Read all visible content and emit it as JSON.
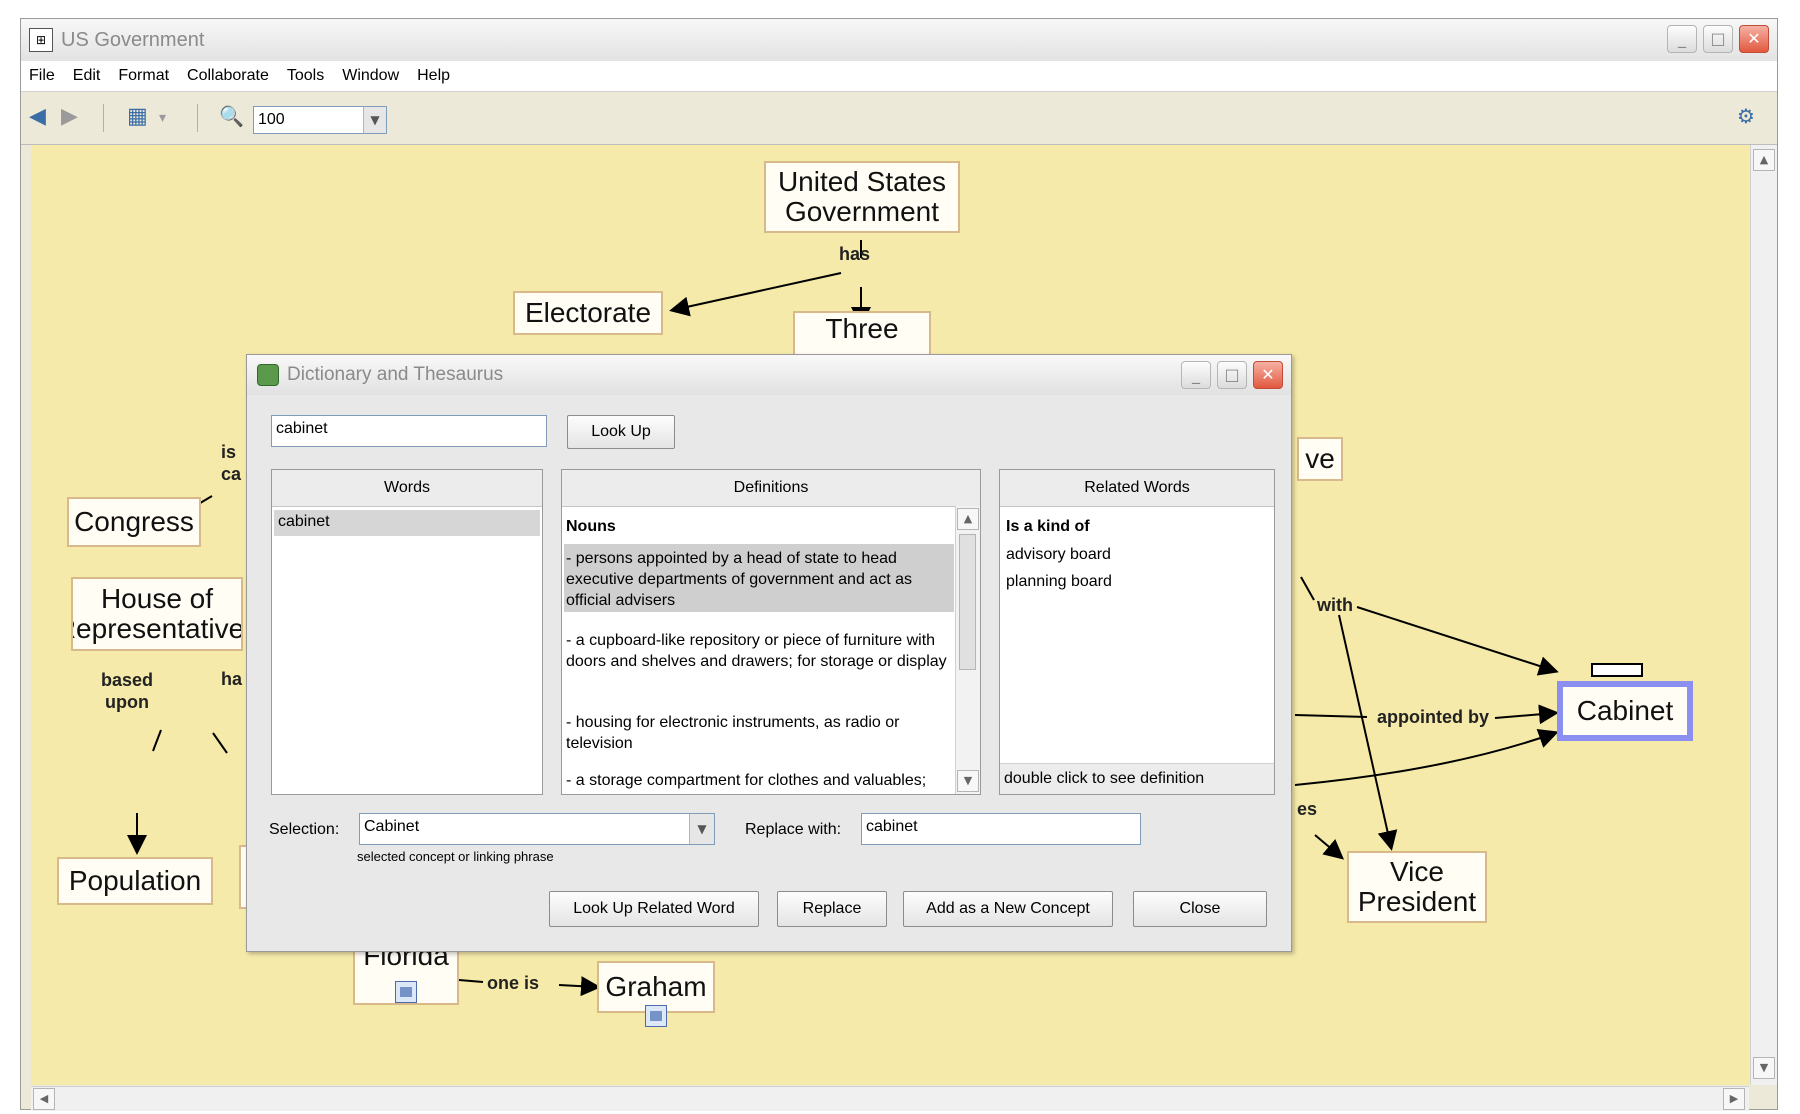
{
  "window": {
    "title": "US Government",
    "controls": {
      "minimize": "_",
      "maximize": "□",
      "close": "✕"
    }
  },
  "menu": [
    "File",
    "Edit",
    "Format",
    "Collaborate",
    "Tools",
    "Window",
    "Help"
  ],
  "toolbar": {
    "back_icon": "◀",
    "forward_icon": "▶",
    "view_icon": "▦",
    "dropdown_arrow": "▾",
    "zoom_icon": "🔍",
    "zoom_value": "100",
    "collab_icon": "⚙"
  },
  "concept_map": {
    "nodes": {
      "usg": "United States\nGovernment",
      "electorate": "Electorate",
      "three": "Three",
      "congress": "Congress",
      "house": "House of\nRepresentatives",
      "population": "Population",
      "ve": "ve",
      "cabinet": "Cabinet",
      "vp": "Vice\nPresident",
      "florida": "Florida",
      "graham": "Graham"
    },
    "labels": {
      "has": "has",
      "is_ca": "is\nca",
      "based_upon": "based\nupon",
      "has_partial": "ha",
      "with": "with",
      "appointed_by": "appointed by",
      "es": "es",
      "one_is": "one is"
    }
  },
  "dialog": {
    "title": "Dictionary and Thesaurus",
    "search_value": "cabinet",
    "lookup_button": "Look Up",
    "words_header": "Words",
    "words": [
      "cabinet"
    ],
    "definitions_header": "Definitions",
    "definitions_section": "Nouns",
    "definitions": [
      "- persons appointed by a head of state to head executive departments of government and act as official advisers",
      "- a cupboard-like repository or piece of furniture with doors and shelves and drawers; for storage or display",
      "- housing for electronic instruments, as radio or television",
      "- a storage compartment for clothes and valuables;"
    ],
    "related_header": "Related Words",
    "related_section": "Is a kind of",
    "related_words": [
      "advisory board",
      "planning board"
    ],
    "related_hint": "double click to see definition",
    "selection_label": "Selection:",
    "selection_value": "Cabinet",
    "selection_hint": "selected concept or linking phrase",
    "replace_label": "Replace with:",
    "replace_value": "cabinet",
    "buttons": {
      "lookup_related": "Look Up Related Word",
      "replace": "Replace",
      "add_concept": "Add as a New Concept",
      "close": "Close"
    }
  }
}
